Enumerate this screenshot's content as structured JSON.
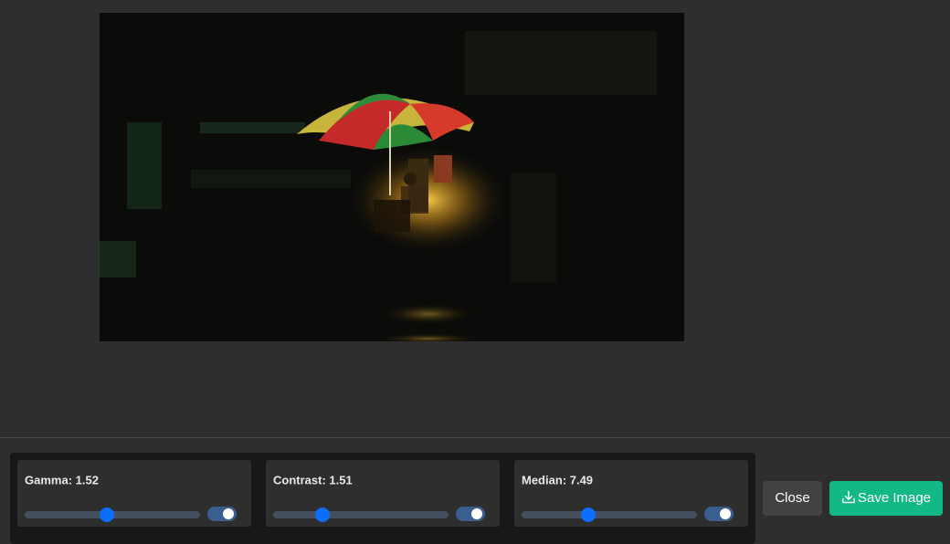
{
  "preview": {
    "icon": "photo-preview"
  },
  "controls": [
    {
      "label": "Gamma: 1.52",
      "slider_fraction": 0.47,
      "enabled": true
    },
    {
      "label": "Contrast: 1.51",
      "slider_fraction": 0.28,
      "enabled": true
    },
    {
      "label": "Median: 7.49",
      "slider_fraction": 0.38,
      "enabled": true
    }
  ],
  "actions": {
    "close_label": "Close",
    "save_label": "Save Image",
    "save_icon": "download-icon",
    "save_color": "#12b886",
    "slider_color": "#0d6efd"
  }
}
